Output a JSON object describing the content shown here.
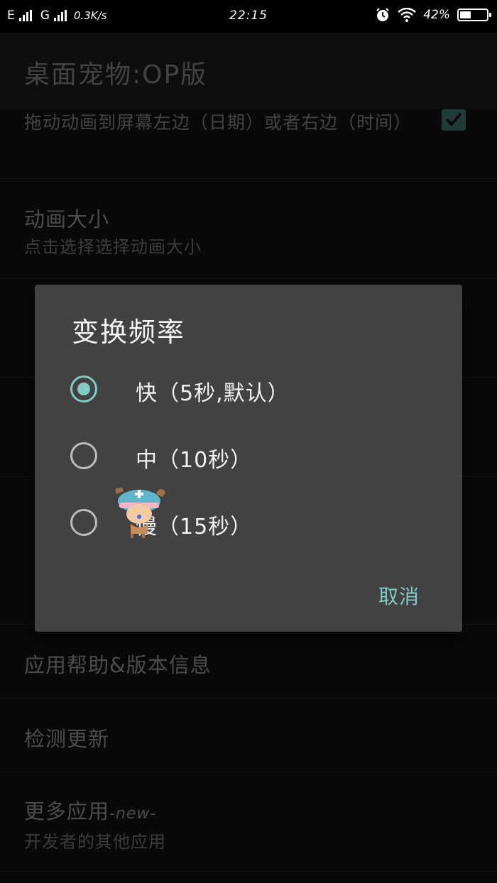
{
  "status_bar": {
    "network1": "E",
    "network2": "G",
    "speed": "0.3K/s",
    "time": "22:15",
    "battery_text": "42%",
    "battery_level": 0.42,
    "icons": [
      "signal-icon",
      "alarm-icon",
      "wifi-icon",
      "battery-icon"
    ]
  },
  "app_bar": {
    "title": "桌面宠物:OP版"
  },
  "settings": {
    "drag_item": {
      "summary": "拖动动画到屏幕左边（日期）或者右边（时间）",
      "checked": true
    },
    "size_item": {
      "title": "动画大小",
      "summary": "点击选择选择动画大小"
    },
    "help_item": {
      "title": "应用帮助&版本信息"
    },
    "update_item": {
      "title": "检测更新"
    },
    "more_apps_item": {
      "title": "更多应用",
      "badge": "-new-",
      "summary": "开发者的其他应用"
    }
  },
  "dialog": {
    "title": "变换频率",
    "options": [
      {
        "label": "快（5秒,默认）",
        "selected": true
      },
      {
        "label": "中（10秒）",
        "selected": false
      },
      {
        "label": "慢（15秒）",
        "selected": false
      }
    ],
    "cancel_label": "取消"
  },
  "colors": {
    "accent": "#80cbc4",
    "dialog_bg": "#424242",
    "background": "#121212"
  }
}
